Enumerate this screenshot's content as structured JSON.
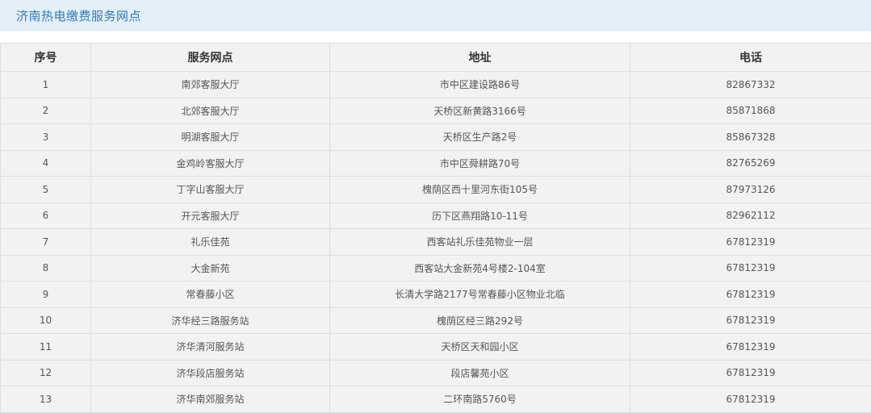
{
  "title": "济南热电缴费服务网点",
  "table": {
    "headers": [
      "序号",
      "服务网点",
      "地址",
      "电话"
    ],
    "rows": [
      [
        "1",
        "南郊客服大厅",
        "市中区建设路86号",
        "82867332"
      ],
      [
        "2",
        "北郊客服大厅",
        "天桥区新黄路3166号",
        "85871868"
      ],
      [
        "3",
        "明湖客服大厅",
        "天桥区生产路2号",
        "85867328"
      ],
      [
        "4",
        "金鸡岭客服大厅",
        "市中区舜耕路70号",
        "82765269"
      ],
      [
        "5",
        "丁字山客服大厅",
        "槐荫区西十里河东街105号",
        "87973126"
      ],
      [
        "6",
        "开元客服大厅",
        "历下区燕翔路10-11号",
        "82962112"
      ],
      [
        "7",
        "礼乐佳苑",
        "西客站礼乐佳苑物业一层",
        "67812319"
      ],
      [
        "8",
        "大金新苑",
        "西客站大金新苑4号楼2-104室",
        "67812319"
      ],
      [
        "9",
        "常春藤小区",
        "长清大学路2177号常春藤小区物业北临",
        "67812319"
      ],
      [
        "10",
        "济华经三路服务站",
        "槐荫区经三路292号",
        "67812319"
      ],
      [
        "11",
        "济华清河服务站",
        "天桥区天和园小区",
        "67812319"
      ],
      [
        "12",
        "济华段店服务站",
        "段店馨苑小区",
        "67812319"
      ],
      [
        "13",
        "济华南郊服务站",
        "二环南路5760号",
        "67812319"
      ]
    ]
  },
  "colors": {
    "title_bar_bg": "#e4eff8",
    "title_text": "#2b7bbd",
    "cell_bg": "#f2f2f2",
    "border": "#d9dde1"
  }
}
